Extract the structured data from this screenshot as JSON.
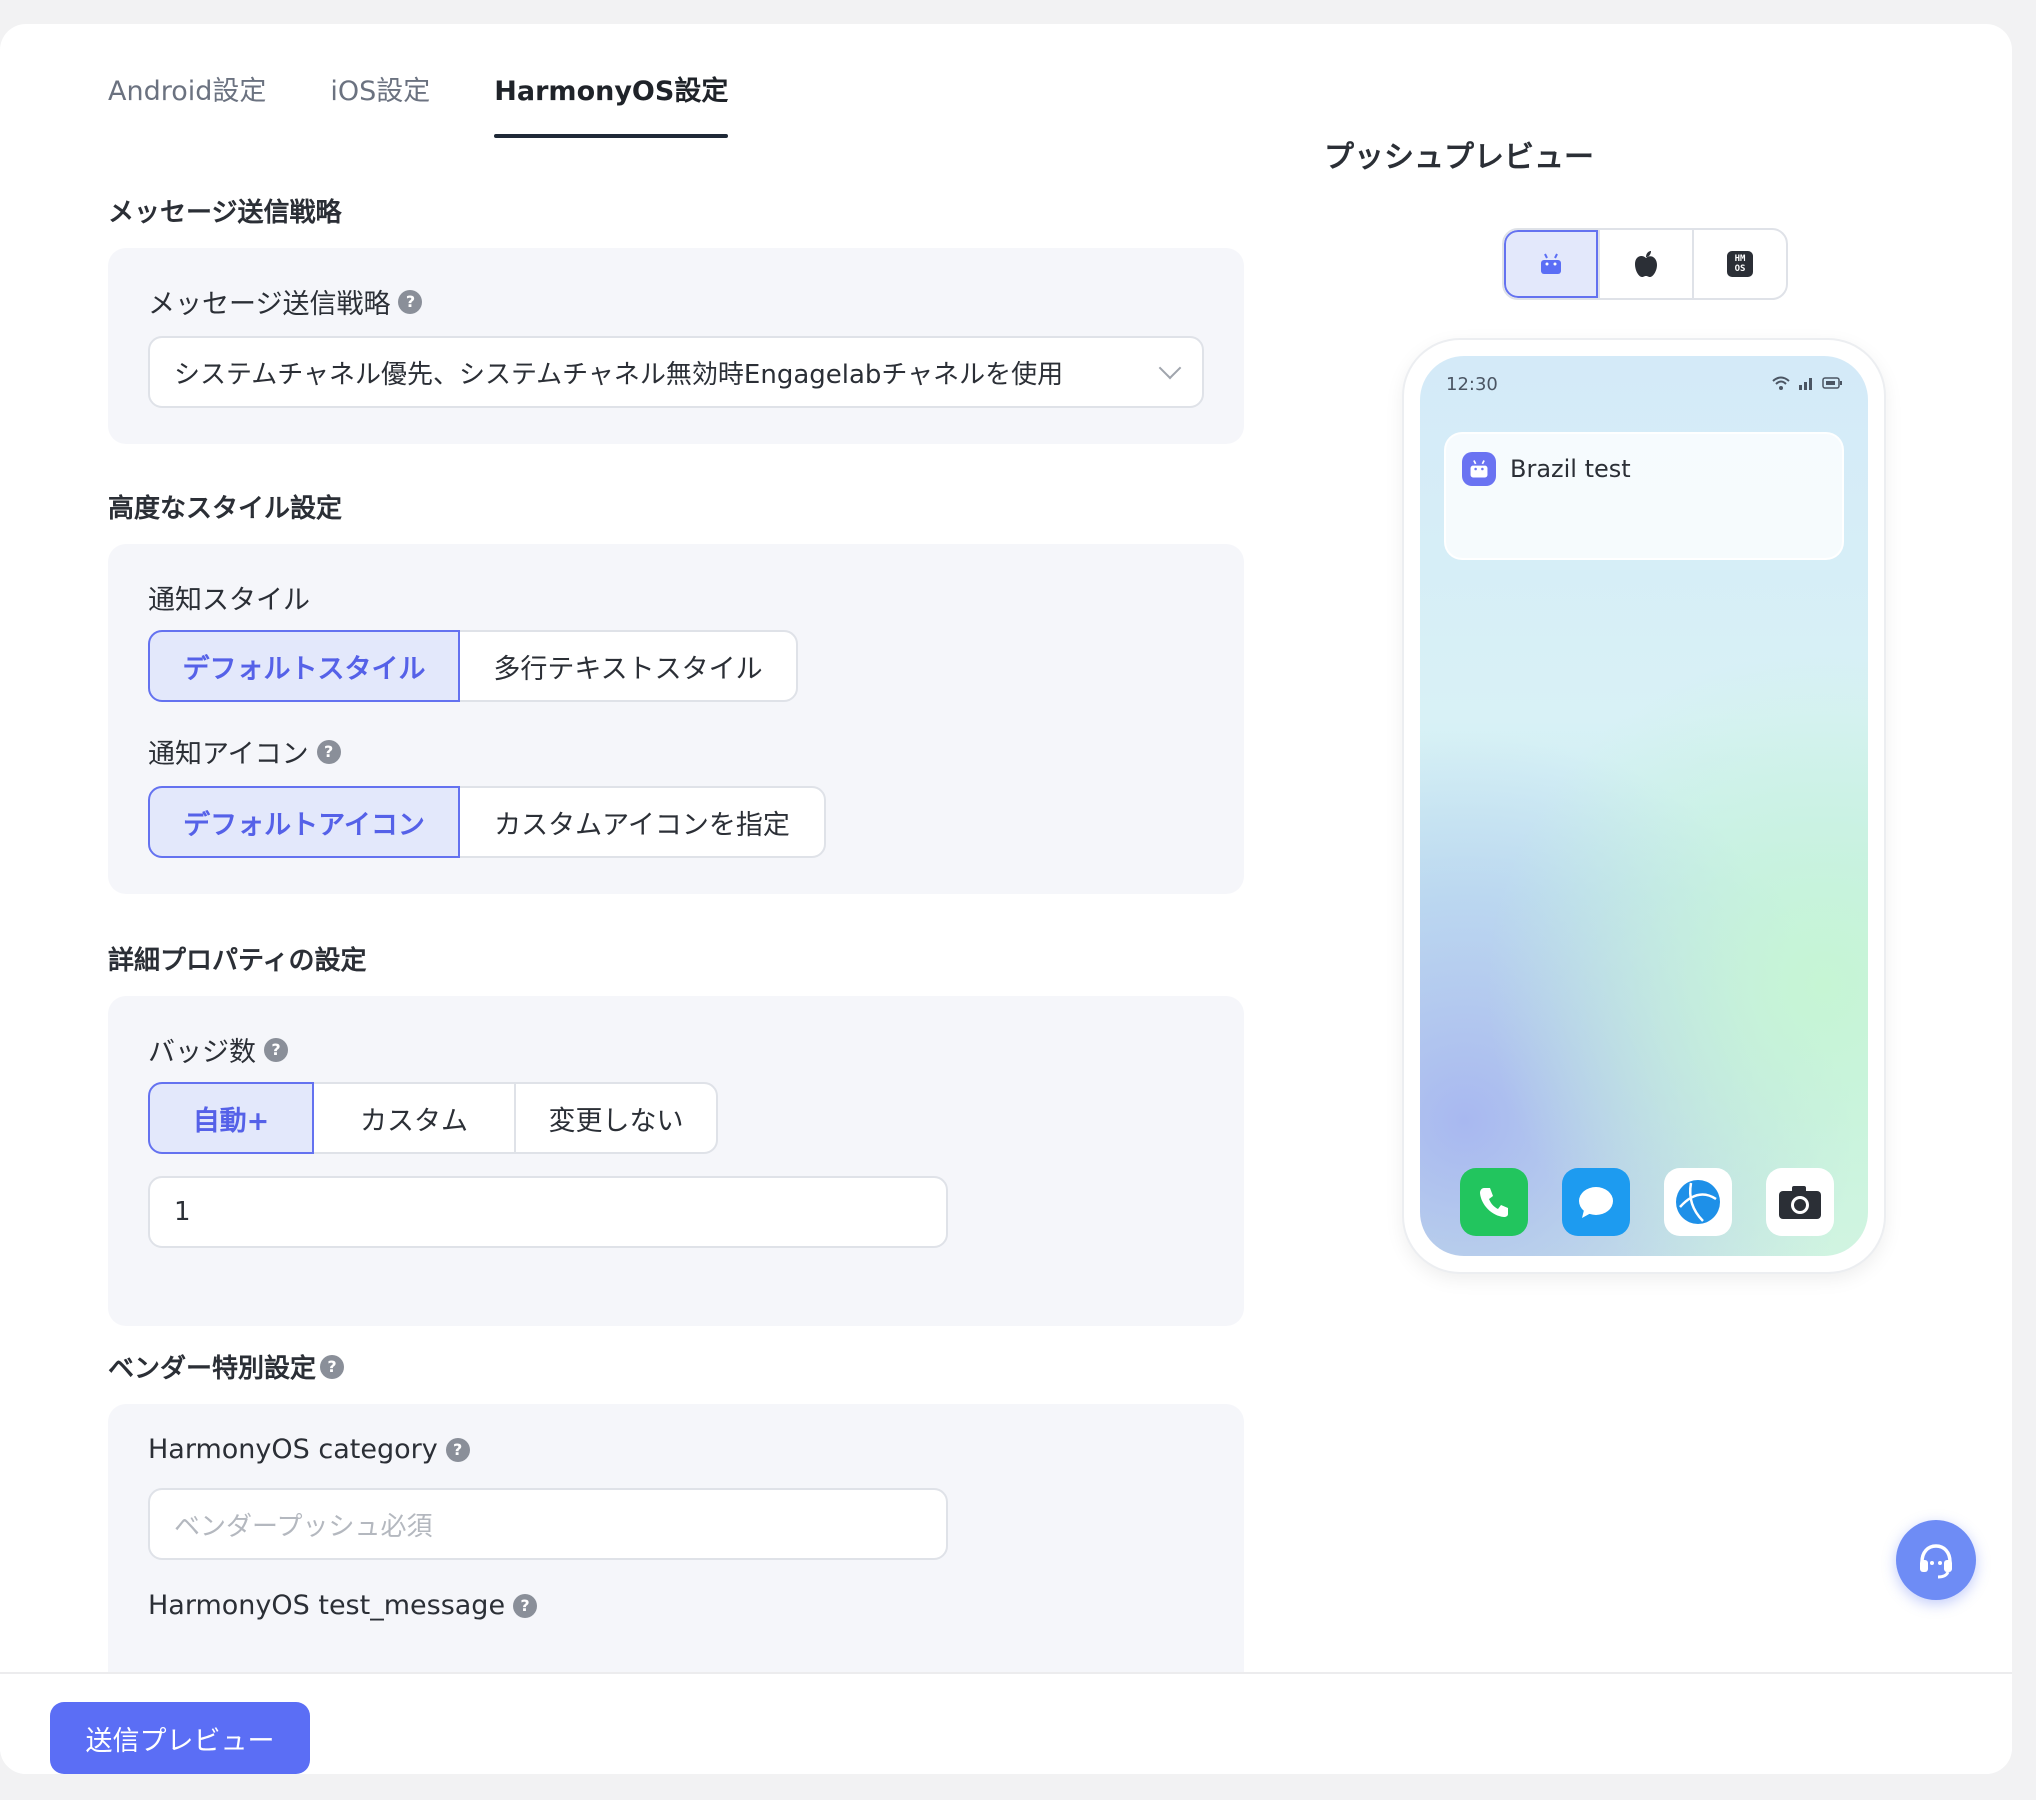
{
  "tabs": [
    {
      "label": "Android設定"
    },
    {
      "label": "iOS設定"
    },
    {
      "label": "HarmonyOS設定"
    }
  ],
  "strategy": {
    "section_title": "メッセージ送信戦略",
    "field_label": "メッセージ送信戦略",
    "selected": "システムチャネル優先、システムチャネル無効時Engagelabチャネルを使用"
  },
  "style": {
    "section_title": "高度なスタイル設定",
    "notif_style_label": "通知スタイル",
    "notif_style_options": [
      "デフォルトスタイル",
      "多行テキストスタイル"
    ],
    "notif_icon_label": "通知アイコン",
    "notif_icon_options": [
      "デフォルトアイコン",
      "カスタムアイコンを指定"
    ]
  },
  "props": {
    "section_title": "詳細プロパティの設定",
    "badge_label": "バッジ数",
    "badge_options": [
      "自動+",
      "カスタム",
      "変更しない"
    ],
    "badge_value": "1"
  },
  "vendor": {
    "section_title": "ベンダー特別設定",
    "category_label": "HarmonyOS category",
    "category_placeholder": "ベンダープッシュ必須",
    "test_message_label": "HarmonyOS test_message"
  },
  "footer": {
    "send_preview": "送信プレビュー"
  },
  "preview": {
    "title": "プッシュプレビュー",
    "platforms": [
      "android-icon",
      "apple-icon",
      "harmonyos-icon"
    ],
    "hm_text": "HM\nOS",
    "status_time": "12:30",
    "notification_title": "Brazil test",
    "dock_apps": [
      "phone-icon",
      "message-icon",
      "browser-icon",
      "camera-icon"
    ]
  },
  "colors": {
    "accent": "#5b6ef5",
    "accent_light": "#e3e8fb",
    "panel_bg": "#f5f6fa"
  }
}
